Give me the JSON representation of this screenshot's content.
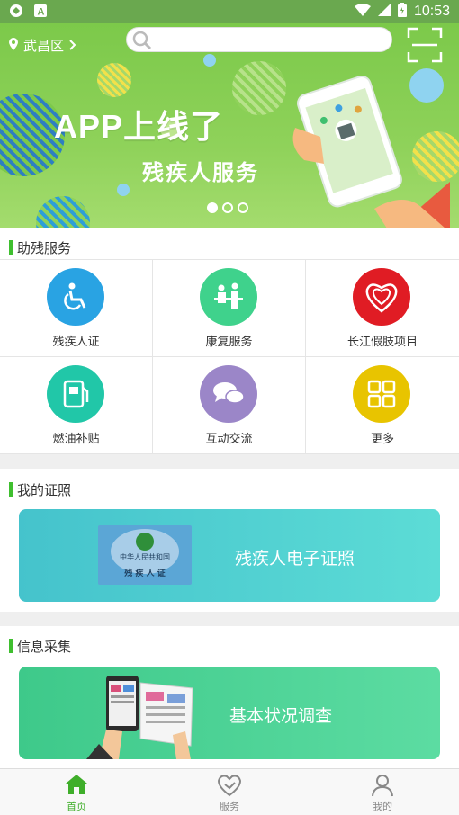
{
  "status_bar": {
    "time": "10:53"
  },
  "header": {
    "location": "武昌区",
    "search_placeholder": ""
  },
  "banner": {
    "title": "APP上线了",
    "subtitle": "残疾人服务",
    "page_count": 3,
    "active_page": 0
  },
  "sections": {
    "services": {
      "title": "助残服务"
    },
    "certificates": {
      "title": "我的证照"
    },
    "info": {
      "title": "信息采集"
    }
  },
  "services": [
    {
      "label": "残疾人证",
      "icon": "wheelchair-icon",
      "color": "#29a3e3"
    },
    {
      "label": "康复服务",
      "icon": "rehab-icon",
      "color": "#3fd28c"
    },
    {
      "label": "长江假肢项目",
      "icon": "heart-hand-icon",
      "color": "#e01c24"
    },
    {
      "label": "燃油补贴",
      "icon": "fuel-icon",
      "color": "#21c7a8"
    },
    {
      "label": "互动交流",
      "icon": "chat-icon",
      "color": "#9b86c8"
    },
    {
      "label": "更多",
      "icon": "grid-icon",
      "color": "#e8c400"
    }
  ],
  "certificate_card": {
    "label": "残疾人电子证照",
    "card_country": "中华人民共和国",
    "card_name": "残 疾 人 证",
    "color": "#4ecfd4"
  },
  "survey_card": {
    "label": "基本状况调查",
    "color": "#3fcf8e"
  },
  "tabs": [
    {
      "label": "首页",
      "icon": "home-icon",
      "active": true
    },
    {
      "label": "服务",
      "icon": "heart-icon",
      "active": false
    },
    {
      "label": "我的",
      "icon": "user-icon",
      "active": false
    }
  ],
  "colors": {
    "accent": "#3fbf2f",
    "banner": "#8fd25a"
  }
}
